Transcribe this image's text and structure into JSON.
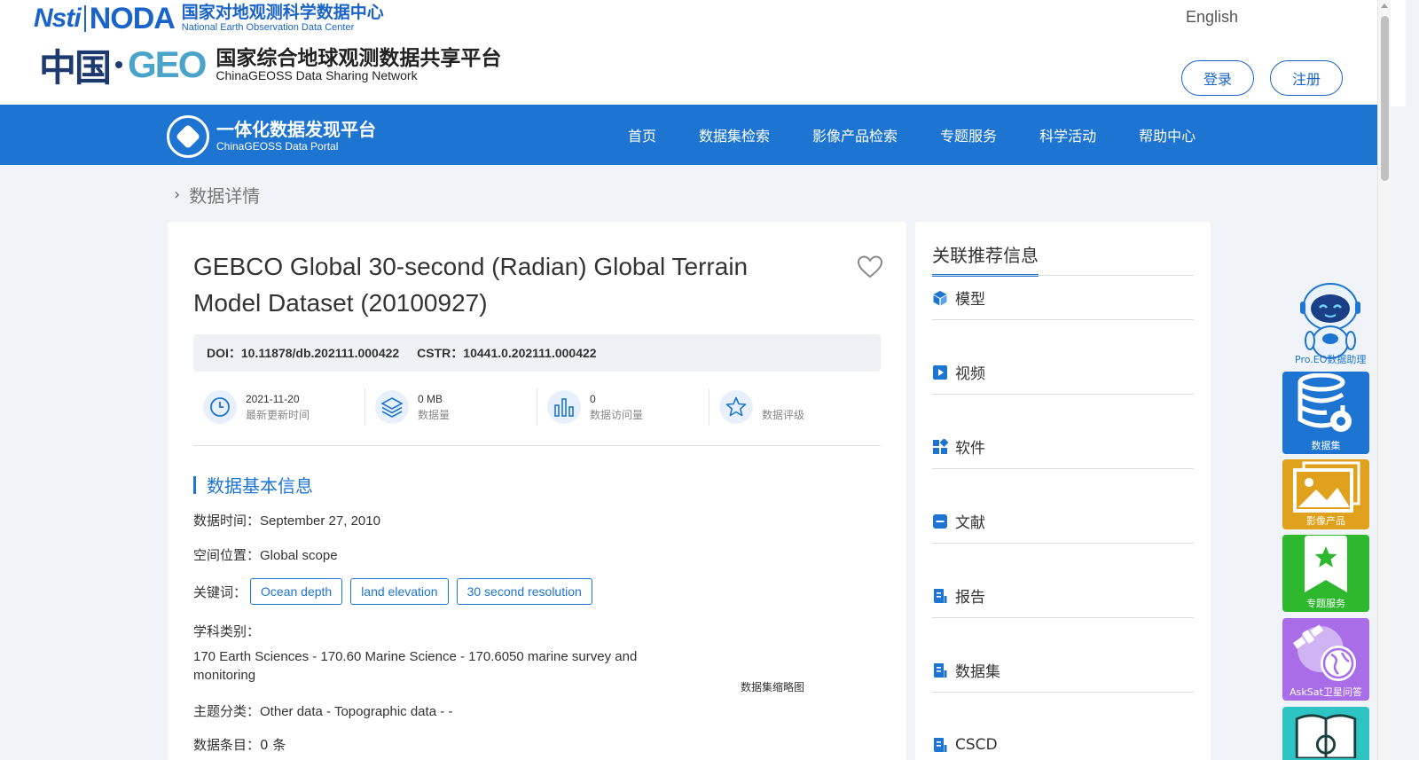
{
  "header": {
    "logo1_nsti": "Nsti",
    "logo1_noda": "NODA",
    "logo1_cn": "国家对地观测科学数据中心",
    "logo1_en": "National Earth Observation Data Center",
    "logo2_zhongguo": "中国",
    "logo2_geo": "GEO",
    "logo2_cn": "国家综合地球观测数据共享平台",
    "logo2_en": "ChinaGEOSS Data Sharing Network",
    "language": "English",
    "login": "登录",
    "register": "注册"
  },
  "nav": {
    "portal_cn": "一体化数据发现平台",
    "portal_en": "ChinaGEOSS Data Portal",
    "items": [
      "首页",
      "数据集检索",
      "影像产品检索",
      "专题服务",
      "科学活动",
      "帮助中心"
    ]
  },
  "breadcrumb": "数据详情",
  "dataset": {
    "title": "GEBCO Global 30-second (Radian) Global Terrain Model Dataset (20100927)",
    "doi_label": "DOI：",
    "doi": "10.11878/db.202111.000422",
    "cstr_label": "CSTR：",
    "cstr": "10441.0.202111.000422",
    "stats": [
      {
        "value": "2021-11-20",
        "label": "最新更新时间"
      },
      {
        "value": "0 MB",
        "label": "数据量"
      },
      {
        "value": "0",
        "label": "数据访问量"
      },
      {
        "value": "",
        "label": "数据评级"
      }
    ],
    "section_title": "数据基本信息",
    "time_label": "数据时间：",
    "time_value": "September 27, 2010",
    "space_label": "空间位置：",
    "space_value": "Global scope",
    "keywords_label": "关键词：",
    "keywords": [
      "Ocean depth",
      "land elevation",
      "30 second resolution"
    ],
    "subject_label": "学科类别：",
    "subject_value": "170 Earth Sciences - 170.60 Marine Science - 170.6050 marine survey and monitoring",
    "theme_label": "主题分类：",
    "theme_value": "Other data - Topographic data - -",
    "count_label": "数据条目：",
    "count_value": "0 条",
    "thumbnail_caption": "数据集缩略图"
  },
  "side": {
    "title": "关联推荐信息",
    "items": [
      "模型",
      "视频",
      "软件",
      "文献",
      "报告",
      "数据集",
      "CSCD"
    ]
  },
  "dock": {
    "assistant": "Pro.EO数据助理",
    "tiles": [
      "数据集",
      "影像产品",
      "专题服务",
      "AskSat卫星问答"
    ]
  },
  "colors": {
    "primary": "#1d74d1",
    "tile_dataset": "#1d74d1",
    "tile_image": "#e0a21c",
    "tile_theme": "#2eb82e",
    "tile_asksat": "#a96de8",
    "tile_next": "#2ec4c4"
  }
}
